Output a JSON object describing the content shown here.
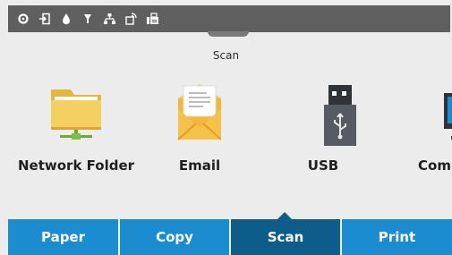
{
  "status_bar": {
    "icons": [
      "settings-icon",
      "sign-in-icon",
      "ink-drop-icon",
      "supplies-icon",
      "network-icon",
      "wifi-direct-icon",
      "fax-icon"
    ]
  },
  "header": {
    "title": "Scan"
  },
  "destinations": [
    {
      "label": "Network Folder",
      "icon": "network-folder-icon"
    },
    {
      "label": "Email",
      "icon": "email-envelope-icon"
    },
    {
      "label": "USB",
      "icon": "usb-drive-icon"
    },
    {
      "label": "Comp",
      "icon": "computer-monitor-icon"
    }
  ],
  "tabs": [
    {
      "label": "Paper",
      "active": false
    },
    {
      "label": "Copy",
      "active": false
    },
    {
      "label": "Scan",
      "active": true
    },
    {
      "label": "Print",
      "active": false
    }
  ],
  "colors": {
    "status_bar": "#5f5f5f",
    "tab": "#1b8cd0",
    "tab_active": "#0d5c8a",
    "background": "#ececec"
  }
}
